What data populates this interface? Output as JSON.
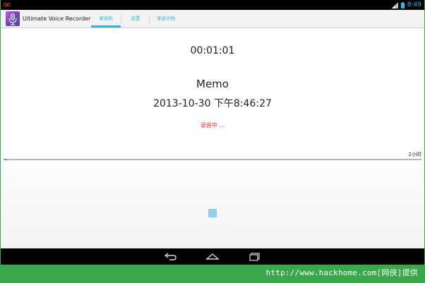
{
  "status_bar": {
    "time": "8:49",
    "icons": [
      "voicemail-icon",
      "signal-icon",
      "battery-icon"
    ]
  },
  "action_bar": {
    "app_title": "Ultimate Voice Recorder",
    "app_icon": "microphone-app-icon",
    "tabs": [
      {
        "label": "录音机",
        "selected": true
      },
      {
        "label": "设置",
        "selected": false
      },
      {
        "label": "录音文档",
        "selected": false
      }
    ]
  },
  "recorder": {
    "elapsed": "00:01:01",
    "memo_title": "Memo",
    "memo_datetime": "2013-10-30 下午8:46:27",
    "status": "录音中 ...",
    "max_duration": "2小时",
    "progress_fraction": 0.0085,
    "stop_icon": "stop-icon"
  },
  "nav_bar": {
    "buttons": [
      "back-icon",
      "home-icon",
      "recents-icon"
    ]
  },
  "watermark": "http://www.hackhome.com[网侠]提供",
  "colors": {
    "accent": "#33b5e5",
    "recording": "#e02a2a",
    "frame": "#3aa84a"
  }
}
